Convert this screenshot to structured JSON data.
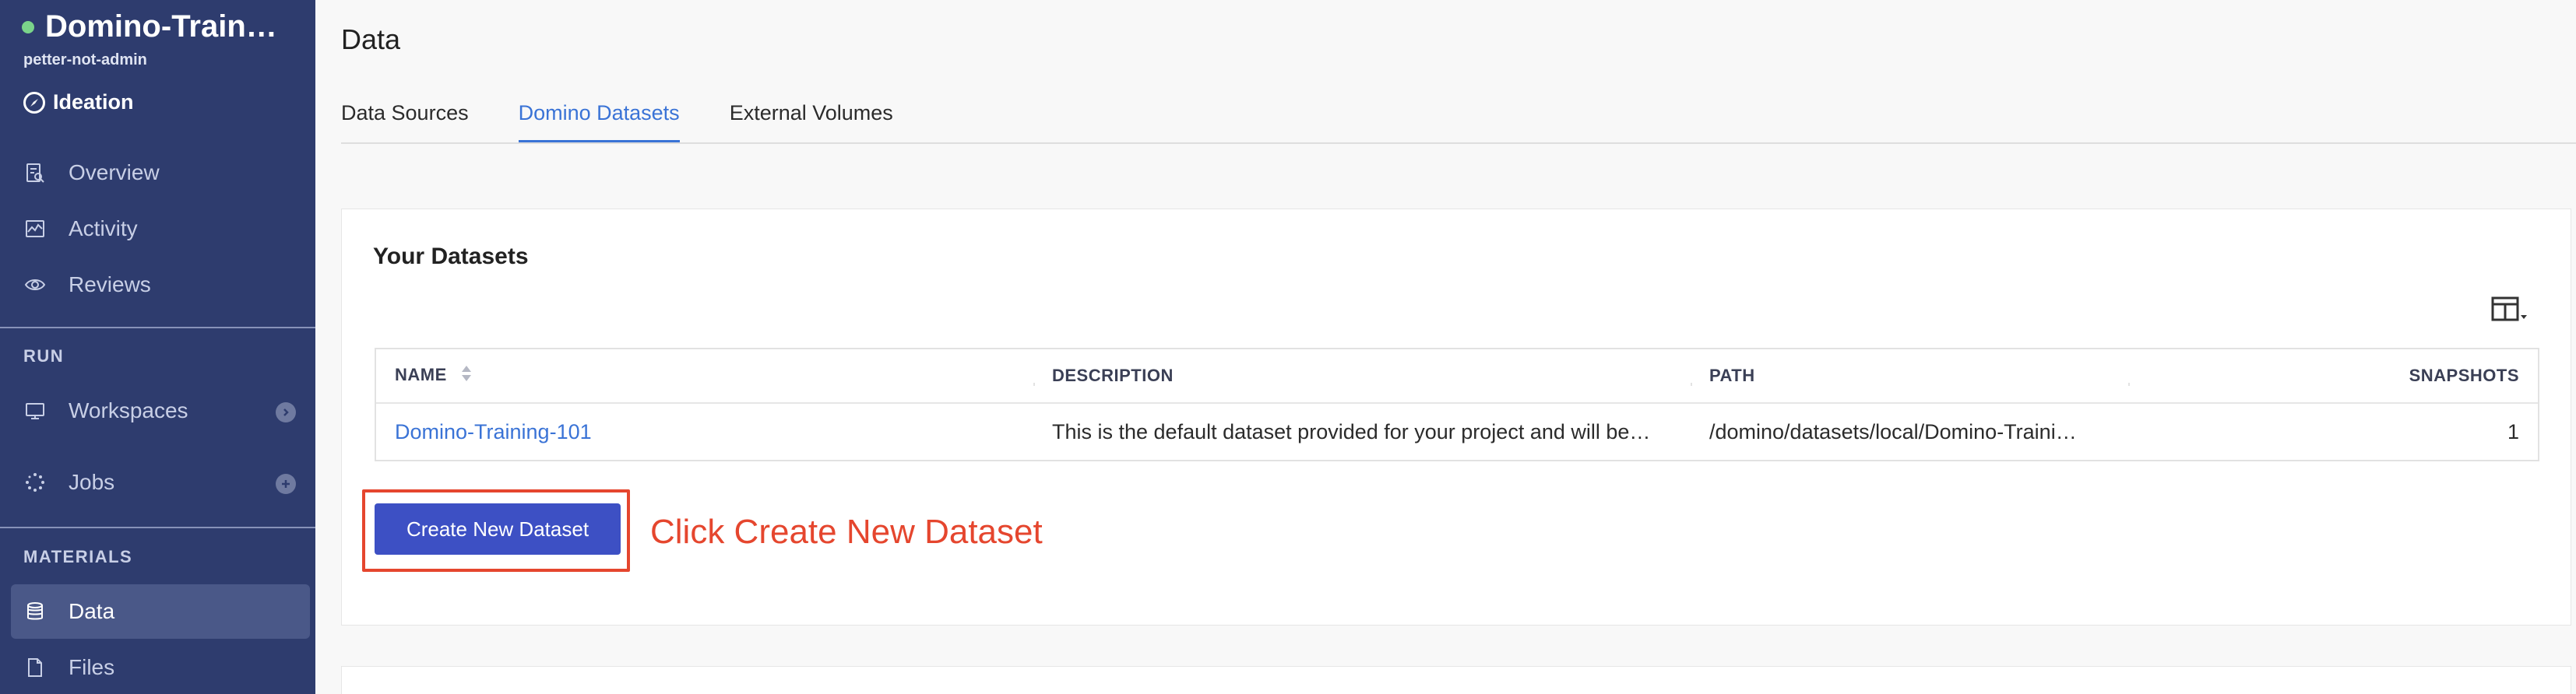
{
  "sidebar": {
    "project_name": "Domino-Train…",
    "owner": "petter-not-admin",
    "stage": "Ideation",
    "items_top": [
      {
        "label": "Overview",
        "icon": "overview-icon"
      },
      {
        "label": "Activity",
        "icon": "activity-icon"
      },
      {
        "label": "Reviews",
        "icon": "eye-icon"
      }
    ],
    "run_section": "RUN",
    "run_items": [
      {
        "label": "Workspaces",
        "icon": "monitor-icon",
        "trail": "chevron-right-icon"
      },
      {
        "label": "Jobs",
        "icon": "jobs-icon",
        "trail": "plus-icon"
      }
    ],
    "materials_section": "MATERIALS",
    "materials_items": [
      {
        "label": "Data",
        "icon": "database-icon",
        "active": true
      },
      {
        "label": "Files",
        "icon": "file-icon"
      }
    ]
  },
  "main": {
    "title": "Data",
    "tabs": [
      {
        "label": "Data Sources"
      },
      {
        "label": "Domino Datasets",
        "active": true
      },
      {
        "label": "External Volumes"
      }
    ],
    "card": {
      "title": "Your Datasets",
      "table": {
        "headers": [
          "NAME",
          "DESCRIPTION",
          "PATH",
          "SNAPSHOTS"
        ],
        "rows": [
          [
            "Domino-Training-101",
            "This is the default dataset provided for your project and will be…",
            "/domino/datasets/local/Domino-Traini…",
            "1"
          ]
        ]
      },
      "create_button": "Create New Dataset",
      "callout": "Click Create New Dataset"
    }
  },
  "colors": {
    "sidebar_bg": "#2e3c6e",
    "accent": "#3a73d6",
    "button": "#3d50c4",
    "annotation": "#e5462e"
  }
}
